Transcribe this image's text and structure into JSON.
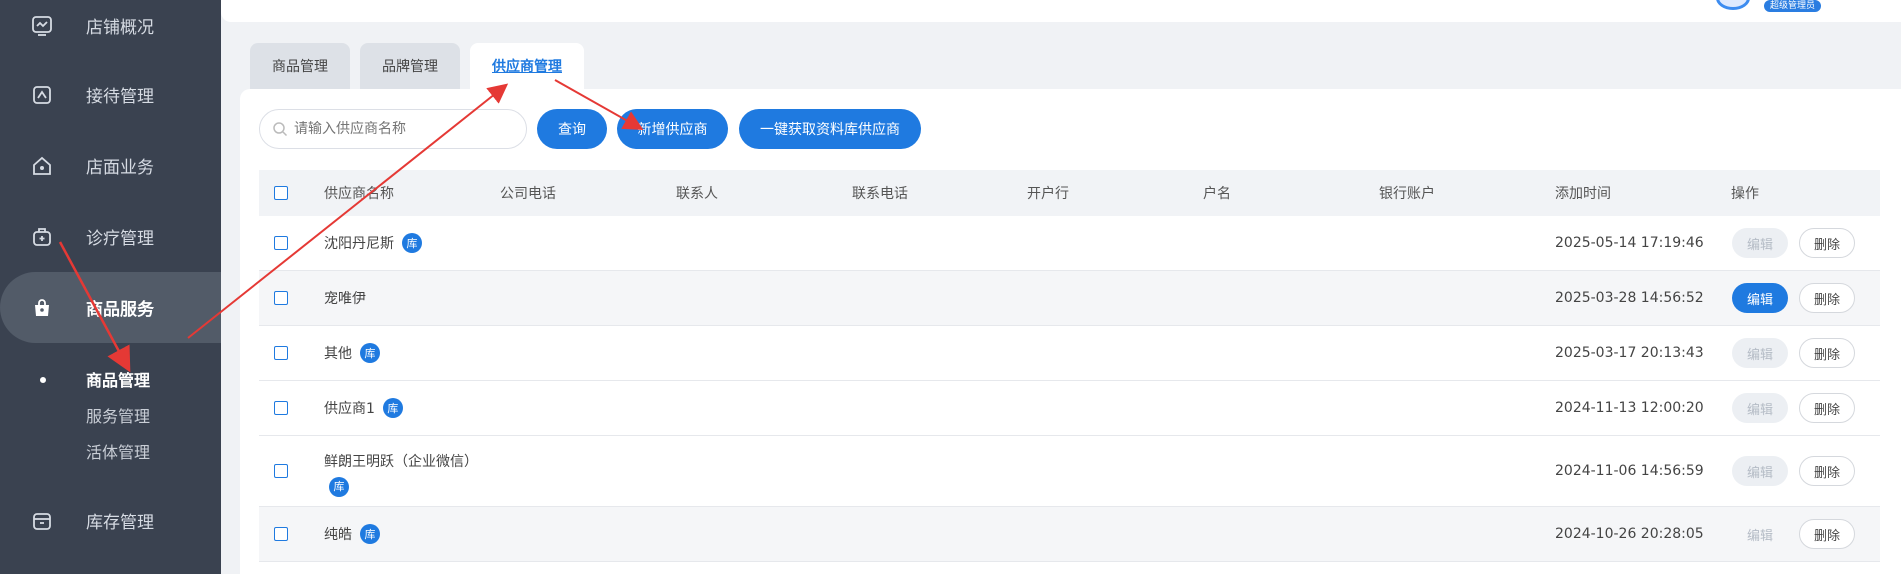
{
  "sidebar": {
    "items": [
      {
        "label": "店铺概况",
        "icon": "dashboard-icon"
      },
      {
        "label": "接待管理",
        "icon": "reception-icon"
      },
      {
        "label": "店面业务",
        "icon": "store-icon"
      },
      {
        "label": "诊疗管理",
        "icon": "medical-kit-icon"
      },
      {
        "label": "商品服务",
        "icon": "shopping-bag-icon"
      },
      {
        "label": "库存管理",
        "icon": "inventory-icon"
      }
    ],
    "sub_items": [
      {
        "label": "商品管理"
      },
      {
        "label": "服务管理"
      },
      {
        "label": "活体管理"
      }
    ]
  },
  "header": {
    "badge": "超级管理员"
  },
  "tabs": [
    {
      "label": "商品管理"
    },
    {
      "label": "品牌管理"
    },
    {
      "label": "供应商管理"
    }
  ],
  "toolbar": {
    "search_placeholder": "请输入供应商名称",
    "query_label": "查询",
    "add_label": "新增供应商",
    "fetch_label": "一键获取资料库供应商"
  },
  "table": {
    "columns": [
      "供应商名称",
      "公司电话",
      "联系人",
      "联系电话",
      "开户行",
      "户名",
      "银行账户",
      "添加时间",
      "操作"
    ],
    "tag_label": "库",
    "edit_label": "编辑",
    "delete_label": "删除",
    "rows": [
      {
        "name": "沈阳丹尼斯",
        "time": "2025-05-14 17:19:46"
      },
      {
        "name": "宠唯伊",
        "time": "2025-03-28 14:56:52"
      },
      {
        "name": "其他",
        "time": "2025-03-17 20:13:43"
      },
      {
        "name": "供应商1",
        "time": "2024-11-13 12:00:20"
      },
      {
        "name": "鲜朗王明跃（企业微信）",
        "time": "2024-11-06 14:56:59"
      },
      {
        "name": "纯皓",
        "time": "2024-10-26 20:28:05"
      }
    ]
  },
  "colors": {
    "accent": "#1f7ae0",
    "sidebar": "#3a4250",
    "annotation": "#e53935"
  }
}
